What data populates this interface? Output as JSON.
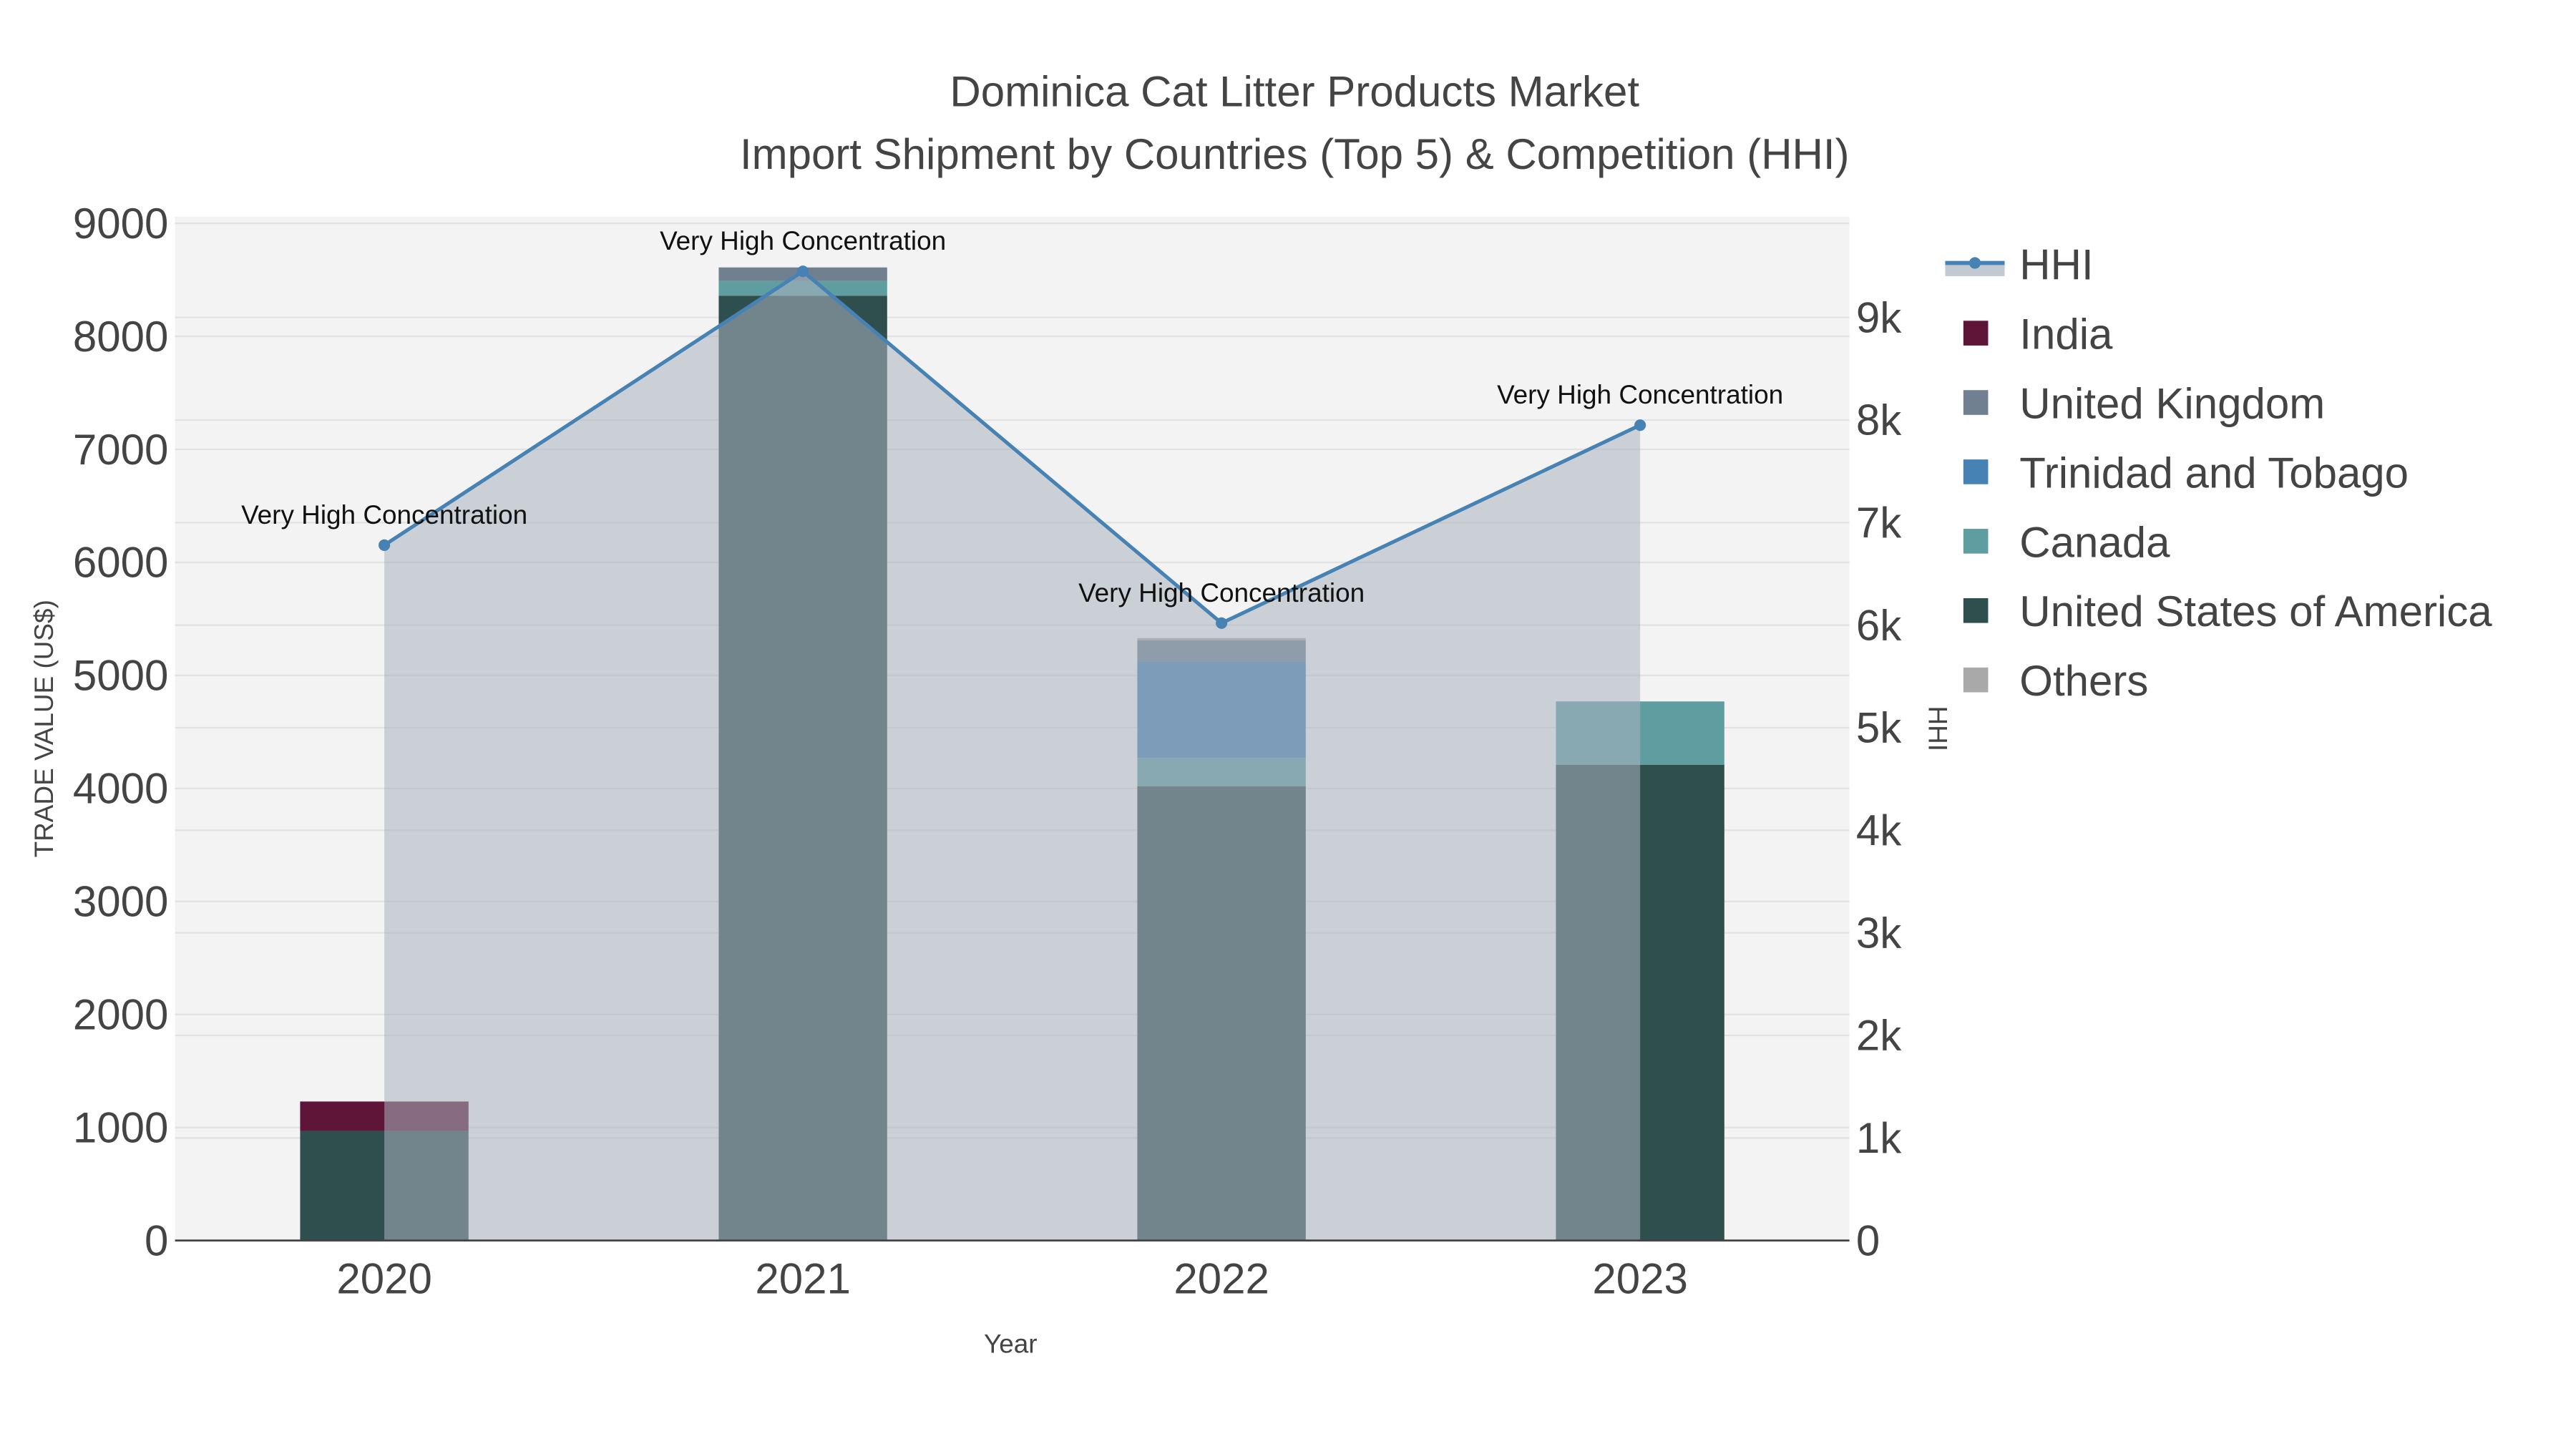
{
  "chart_data": {
    "type": "bar",
    "title": "Dominica Cat Litter Products Market",
    "subtitle": "Import Shipment by Countries (Top 5) & Competition (HHI)",
    "xlabel": "Year",
    "ylabel": "TRADE VALUE (US$)",
    "y2label": "HHI",
    "categories": [
      "2020",
      "2021",
      "2022",
      "2023"
    ],
    "ylim": [
      0,
      9000
    ],
    "y2lim": [
      0,
      10000
    ],
    "yticks": [
      "0",
      "1000",
      "2000",
      "3000",
      "4000",
      "5000",
      "6000",
      "7000",
      "8000",
      "9000"
    ],
    "y2ticks": [
      "0",
      "1k",
      "2k",
      "3k",
      "4k",
      "5k",
      "6k",
      "7k",
      "8k",
      "9k"
    ],
    "stacked": true,
    "series": [
      {
        "name": "United States of America",
        "color": "#2F4F4F",
        "values": [
          970,
          8360,
          4020,
          4210
        ]
      },
      {
        "name": "Canada",
        "color": "#5F9EA0",
        "values": [
          0,
          130,
          250,
          560
        ]
      },
      {
        "name": "Trinidad and Tobago",
        "color": "#4682B4",
        "values": [
          0,
          0,
          850,
          0
        ]
      },
      {
        "name": "United Kingdom",
        "color": "#708090",
        "values": [
          0,
          120,
          190,
          0
        ]
      },
      {
        "name": "India",
        "color": "#5E1537",
        "values": [
          260,
          0,
          0,
          0
        ]
      },
      {
        "name": "Others",
        "color": "#A9A9A9",
        "values": [
          0,
          0,
          20,
          0
        ]
      }
    ],
    "hhi": {
      "name": "HHI",
      "color": "#4682B4",
      "values": [
        6780,
        9450,
        6020,
        7950
      ],
      "annotations": [
        "Very High Concentration",
        "Very High Concentration",
        "Very High Concentration",
        "Very High Concentration"
      ]
    },
    "legend_order": [
      "HHI",
      "India",
      "United Kingdom",
      "Trinidad and Tobago",
      "Canada",
      "United States of America",
      "Others"
    ],
    "legend_position": "right",
    "grid": true
  }
}
